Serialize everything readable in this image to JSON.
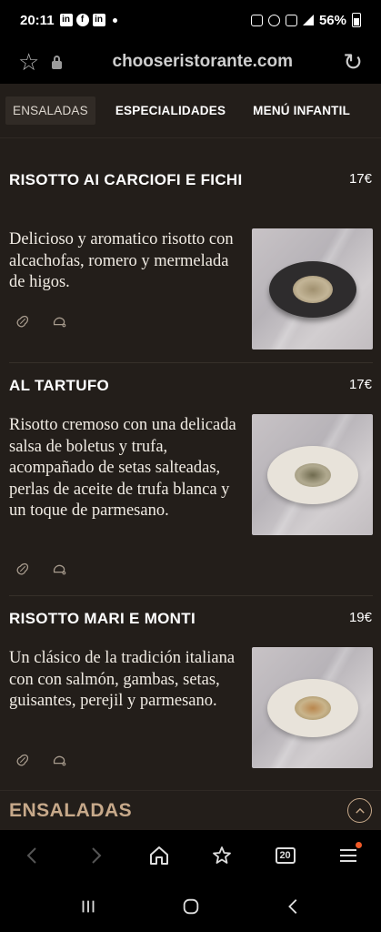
{
  "status_bar": {
    "time": "20:11",
    "app_icons": [
      "in",
      "f",
      "in"
    ],
    "battery": "56%"
  },
  "browser": {
    "url": "chooseristorante.com"
  },
  "tabs": [
    {
      "label": "ENSALADAS",
      "active": true
    },
    {
      "label": "ESPECIALIDADES",
      "active": false
    },
    {
      "label": "MENÚ INFANTIL",
      "active": false
    }
  ],
  "dishes": [
    {
      "name": "RISOTTO AI CARCIOFI E FICHI",
      "price": "17€",
      "description": "Delicioso y aromatico risotto con alcachofas, romero y mermelada de higos.",
      "allergen_icons": [
        "peanut-icon",
        "shellfish-icon"
      ]
    },
    {
      "name": "AL TARTUFO",
      "price": "17€",
      "description": "Risotto cremoso con una delicada salsa de boletus y trufa, acompañado de setas salteadas, perlas de aceite de trufa blanca y un toque de parmesano.",
      "allergen_icons": [
        "peanut-icon",
        "shellfish-icon"
      ]
    },
    {
      "name": "RISOTTO MARI E MONTI",
      "price": "19€",
      "description": "Un clásico de la tradición italiana con con salmón, gambas, setas, guisantes, perejil y parmesano.",
      "allergen_icons": [
        "peanut-icon",
        "shellfish-icon"
      ]
    }
  ],
  "section_footer": {
    "title": "ENSALADAS"
  },
  "bottom_nav": {
    "tab_count": "20"
  },
  "colors": {
    "page_bg": "#231e1a",
    "accent": "#c7a98a",
    "notification": "#f05a28"
  }
}
